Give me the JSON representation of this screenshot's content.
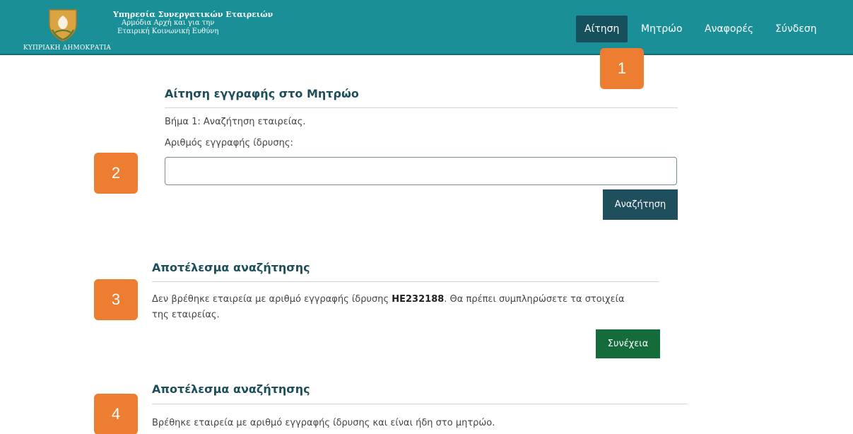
{
  "header": {
    "logo_text": "ΚΥΠΡΙΑΚΗ ΔΗΜΟΚΡΑΤΙΑ",
    "agency_title": "Υπηρεσία Συνεργατικών Εταιρειών",
    "agency_line2": "Αρμόδια Αρχή και για την",
    "agency_line3": "Εταιρική Κοινωνική Ευθύνη",
    "bg_color": "#1b8f97"
  },
  "nav": {
    "items": [
      {
        "label": "Αίτηση",
        "active": true
      },
      {
        "label": "Μητρώο",
        "active": false
      },
      {
        "label": "Αναφορές",
        "active": false
      },
      {
        "label": "Σύνδεση",
        "active": false
      }
    ]
  },
  "badges": [
    "1",
    "2",
    "3",
    "4"
  ],
  "form": {
    "title": "Αίτηση εγγραφής στο Μητρώο",
    "step": "Βήμα 1: Αναζήτηση εταιρείας.",
    "field_label": "Αριθμός εγγραφής ίδρυσης:",
    "field_value": "",
    "search_button": "Αναζήτηση"
  },
  "result_not_found": {
    "title": "Αποτέλεσμα αναζήτησης",
    "text_before": "Δεν βρέθηκε εταιρεία με αριθμό εγγραφής ίδρυσης ",
    "registration_number": "HE232188",
    "text_after": ". Θα πρέπει συμπληρώσετε τα στοιχεία",
    "text_line2": "της εταιρείας.",
    "continue_button": "Συνέχεια"
  },
  "result_found": {
    "title": "Αποτέλεσμα αναζήτησης",
    "text": "Βρέθηκε εταιρεία με αριθμό εγγραφής ίδρυσης και είναι ήδη στο μητρώο."
  },
  "colors": {
    "badge": "#ed7d31",
    "nav_active": "#16505c",
    "search_button": "#1f4e5d",
    "continue_button": "#146c3b",
    "section_title": "#1d4f5a"
  }
}
